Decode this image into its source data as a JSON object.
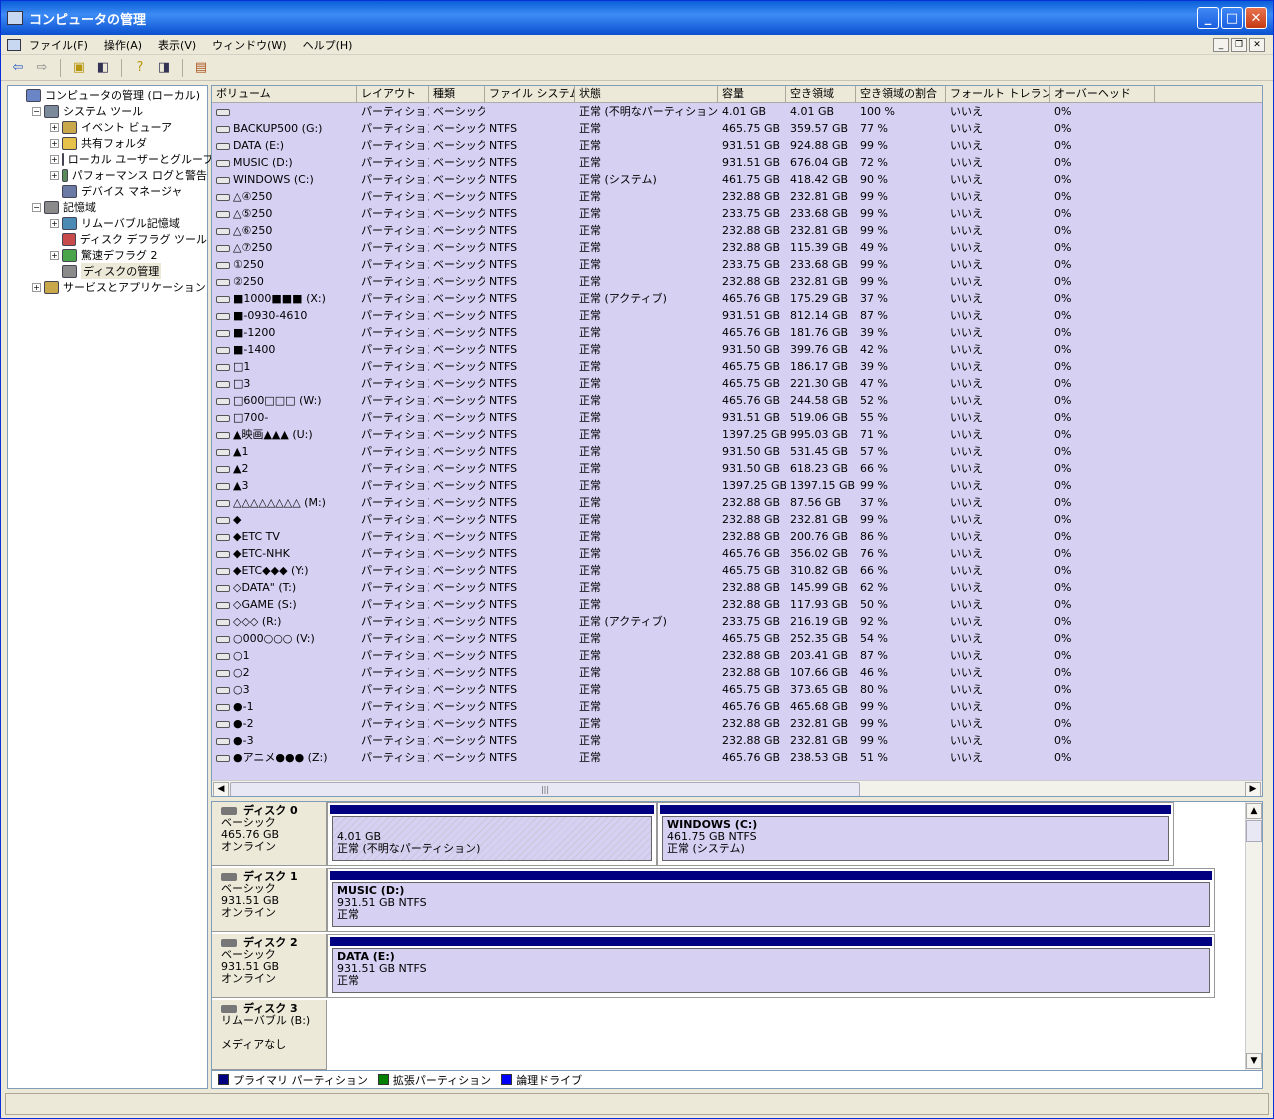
{
  "window": {
    "title": "コンピュータの管理"
  },
  "menu": [
    "ファイル(F)",
    "操作(A)",
    "表示(V)",
    "ウィンドウ(W)",
    "ヘルプ(H)"
  ],
  "tree": [
    {
      "label": "コンピュータの管理 (ローカル)",
      "level": 0,
      "exp": "",
      "icon": "computer-icon",
      "color": "#6b86c7"
    },
    {
      "label": "システム ツール",
      "level": 1,
      "exp": "⊟",
      "icon": "tools-icon",
      "color": "#7a8a9a"
    },
    {
      "label": "イベント ビューア",
      "level": 2,
      "exp": "⊞",
      "icon": "event-viewer-icon",
      "color": "#c8a84a"
    },
    {
      "label": "共有フォルダ",
      "level": 2,
      "exp": "⊞",
      "icon": "shared-folder-icon",
      "color": "#e6c24a"
    },
    {
      "label": "ローカル ユーザーとグループ",
      "level": 2,
      "exp": "⊞",
      "icon": "users-icon",
      "color": "#5a6ab5"
    },
    {
      "label": "パフォーマンス ログと警告",
      "level": 2,
      "exp": "⊞",
      "icon": "performance-icon",
      "color": "#5b8a5b"
    },
    {
      "label": "デバイス マネージャ",
      "level": 2,
      "exp": "",
      "icon": "device-manager-icon",
      "color": "#6a7aa5"
    },
    {
      "label": "記憶域",
      "level": 1,
      "exp": "⊟",
      "icon": "storage-icon",
      "color": "#8a8a8a"
    },
    {
      "label": "リムーバブル記憶域",
      "level": 2,
      "exp": "⊞",
      "icon": "removable-storage-icon",
      "color": "#4a8ab5"
    },
    {
      "label": "ディスク デフラグ ツール",
      "level": 2,
      "exp": "",
      "icon": "defrag-icon",
      "color": "#c84a4a"
    },
    {
      "label": "驚速デフラグ 2",
      "level": 2,
      "exp": "⊞",
      "icon": "defrag2-icon",
      "color": "#4aa54a"
    },
    {
      "label": "ディスクの管理",
      "level": 2,
      "exp": "",
      "icon": "disk-management-icon",
      "color": "#8a8a8a",
      "selected": true
    },
    {
      "label": "サービスとアプリケーション",
      "level": 1,
      "exp": "⊞",
      "icon": "services-icon",
      "color": "#c8a84a"
    }
  ],
  "columns": [
    "ボリューム",
    "レイアウト",
    "種類",
    "ファイル システム",
    "状態",
    "容量",
    "空き領域",
    "空き領域の割合",
    "フォールト トレランス",
    "オーバーヘッド"
  ],
  "rows": [
    [
      "",
      "パーティション",
      "ベーシック",
      "",
      "正常 (不明なパーティション)",
      "4.01 GB",
      "4.01 GB",
      "100 %",
      "いいえ",
      "0%"
    ],
    [
      "BACKUP500 (G:)",
      "パーティション",
      "ベーシック",
      "NTFS",
      "正常",
      "465.75 GB",
      "359.57 GB",
      "77 %",
      "いいえ",
      "0%"
    ],
    [
      "DATA (E:)",
      "パーティション",
      "ベーシック",
      "NTFS",
      "正常",
      "931.51 GB",
      "924.88 GB",
      "99 %",
      "いいえ",
      "0%"
    ],
    [
      "MUSIC (D:)",
      "パーティション",
      "ベーシック",
      "NTFS",
      "正常",
      "931.51 GB",
      "676.04 GB",
      "72 %",
      "いいえ",
      "0%"
    ],
    [
      "WINDOWS (C:)",
      "パーティション",
      "ベーシック",
      "NTFS",
      "正常 (システム)",
      "461.75 GB",
      "418.42 GB",
      "90 %",
      "いいえ",
      "0%"
    ],
    [
      "△④250",
      "パーティション",
      "ベーシック",
      "NTFS",
      "正常",
      "232.88 GB",
      "232.81 GB",
      "99 %",
      "いいえ",
      "0%"
    ],
    [
      "△⑤250",
      "パーティション",
      "ベーシック",
      "NTFS",
      "正常",
      "233.75 GB",
      "233.68 GB",
      "99 %",
      "いいえ",
      "0%"
    ],
    [
      "△⑥250",
      "パーティション",
      "ベーシック",
      "NTFS",
      "正常",
      "232.88 GB",
      "232.81 GB",
      "99 %",
      "いいえ",
      "0%"
    ],
    [
      "△⑦250",
      "パーティション",
      "ベーシック",
      "NTFS",
      "正常",
      "232.88 GB",
      "115.39 GB",
      "49 %",
      "いいえ",
      "0%"
    ],
    [
      "①250",
      "パーティション",
      "ベーシック",
      "NTFS",
      "正常",
      "233.75 GB",
      "233.68 GB",
      "99 %",
      "いいえ",
      "0%"
    ],
    [
      "②250",
      "パーティション",
      "ベーシック",
      "NTFS",
      "正常",
      "232.88 GB",
      "232.81 GB",
      "99 %",
      "いいえ",
      "0%"
    ],
    [
      "■1000■■■ (X:)",
      "パーティション",
      "ベーシック",
      "NTFS",
      "正常 (アクティブ)",
      "465.76 GB",
      "175.29 GB",
      "37 %",
      "いいえ",
      "0%"
    ],
    [
      "■-0930-4610",
      "パーティション",
      "ベーシック",
      "NTFS",
      "正常",
      "931.51 GB",
      "812.14 GB",
      "87 %",
      "いいえ",
      "0%"
    ],
    [
      "■-1200",
      "パーティション",
      "ベーシック",
      "NTFS",
      "正常",
      "465.76 GB",
      "181.76 GB",
      "39 %",
      "いいえ",
      "0%"
    ],
    [
      "■-1400",
      "パーティション",
      "ベーシック",
      "NTFS",
      "正常",
      "931.50 GB",
      "399.76 GB",
      "42 %",
      "いいえ",
      "0%"
    ],
    [
      "□1",
      "パーティション",
      "ベーシック",
      "NTFS",
      "正常",
      "465.75 GB",
      "186.17 GB",
      "39 %",
      "いいえ",
      "0%"
    ],
    [
      "□3",
      "パーティション",
      "ベーシック",
      "NTFS",
      "正常",
      "465.75 GB",
      "221.30 GB",
      "47 %",
      "いいえ",
      "0%"
    ],
    [
      "□600□□□ (W:)",
      "パーティション",
      "ベーシック",
      "NTFS",
      "正常",
      "465.76 GB",
      "244.58 GB",
      "52 %",
      "いいえ",
      "0%"
    ],
    [
      "□700-",
      "パーティション",
      "ベーシック",
      "NTFS",
      "正常",
      "931.51 GB",
      "519.06 GB",
      "55 %",
      "いいえ",
      "0%"
    ],
    [
      "▲映画▲▲▲ (U:)",
      "パーティション",
      "ベーシック",
      "NTFS",
      "正常",
      "1397.25 GB",
      "995.03 GB",
      "71 %",
      "いいえ",
      "0%"
    ],
    [
      "▲1",
      "パーティション",
      "ベーシック",
      "NTFS",
      "正常",
      "931.50 GB",
      "531.45 GB",
      "57 %",
      "いいえ",
      "0%"
    ],
    [
      "▲2",
      "パーティション",
      "ベーシック",
      "NTFS",
      "正常",
      "931.50 GB",
      "618.23 GB",
      "66 %",
      "いいえ",
      "0%"
    ],
    [
      "▲3",
      "パーティション",
      "ベーシック",
      "NTFS",
      "正常",
      "1397.25 GB",
      "1397.15 GB",
      "99 %",
      "いいえ",
      "0%"
    ],
    [
      "△△△△△△△△ (M:)",
      "パーティション",
      "ベーシック",
      "NTFS",
      "正常",
      "232.88 GB",
      "87.56 GB",
      "37 %",
      "いいえ",
      "0%"
    ],
    [
      "◆",
      "パーティション",
      "ベーシック",
      "NTFS",
      "正常",
      "232.88 GB",
      "232.81 GB",
      "99 %",
      "いいえ",
      "0%"
    ],
    [
      "◆ETC TV",
      "パーティション",
      "ベーシック",
      "NTFS",
      "正常",
      "232.88 GB",
      "200.76 GB",
      "86 %",
      "いいえ",
      "0%"
    ],
    [
      "◆ETC-NHK",
      "パーティション",
      "ベーシック",
      "NTFS",
      "正常",
      "465.76 GB",
      "356.02 GB",
      "76 %",
      "いいえ",
      "0%"
    ],
    [
      "◆ETC◆◆◆ (Y:)",
      "パーティション",
      "ベーシック",
      "NTFS",
      "正常",
      "465.75 GB",
      "310.82 GB",
      "66 %",
      "いいえ",
      "0%"
    ],
    [
      "◇DATA\" (T:)",
      "パーティション",
      "ベーシック",
      "NTFS",
      "正常",
      "232.88 GB",
      "145.99 GB",
      "62 %",
      "いいえ",
      "0%"
    ],
    [
      "◇GAME (S:)",
      "パーティション",
      "ベーシック",
      "NTFS",
      "正常",
      "232.88 GB",
      "117.93 GB",
      "50 %",
      "いいえ",
      "0%"
    ],
    [
      "◇◇◇ (R:)",
      "パーティション",
      "ベーシック",
      "NTFS",
      "正常 (アクティブ)",
      "233.75 GB",
      "216.19 GB",
      "92 %",
      "いいえ",
      "0%"
    ],
    [
      "○000○○○ (V:)",
      "パーティション",
      "ベーシック",
      "NTFS",
      "正常",
      "465.75 GB",
      "252.35 GB",
      "54 %",
      "いいえ",
      "0%"
    ],
    [
      "○1",
      "パーティション",
      "ベーシック",
      "NTFS",
      "正常",
      "232.88 GB",
      "203.41 GB",
      "87 %",
      "いいえ",
      "0%"
    ],
    [
      "○2",
      "パーティション",
      "ベーシック",
      "NTFS",
      "正常",
      "232.88 GB",
      "107.66 GB",
      "46 %",
      "いいえ",
      "0%"
    ],
    [
      "○3",
      "パーティション",
      "ベーシック",
      "NTFS",
      "正常",
      "465.75 GB",
      "373.65 GB",
      "80 %",
      "いいえ",
      "0%"
    ],
    [
      "●-1",
      "パーティション",
      "ベーシック",
      "NTFS",
      "正常",
      "465.76 GB",
      "465.68 GB",
      "99 %",
      "いいえ",
      "0%"
    ],
    [
      "●-2",
      "パーティション",
      "ベーシック",
      "NTFS",
      "正常",
      "232.88 GB",
      "232.81 GB",
      "99 %",
      "いいえ",
      "0%"
    ],
    [
      "●-3",
      "パーティション",
      "ベーシック",
      "NTFS",
      "正常",
      "232.88 GB",
      "232.81 GB",
      "99 %",
      "いいえ",
      "0%"
    ],
    [
      "●アニメ●●● (Z:)",
      "パーティション",
      "ベーシック",
      "NTFS",
      "正常",
      "465.76 GB",
      "238.53 GB",
      "51 %",
      "いいえ",
      "0%"
    ]
  ],
  "disks": [
    {
      "name": "ディスク 0",
      "type": "ベーシック",
      "size": "465.76 GB",
      "status": "オンライン",
      "partitions": [
        {
          "name": "",
          "size": "4.01 GB",
          "status": "正常 (不明なパーティション)",
          "hatched": true
        },
        {
          "name": "WINDOWS (C:)",
          "size": "461.75 GB NTFS",
          "status": "正常 (システム)",
          "hatched": false
        }
      ]
    },
    {
      "name": "ディスク 1",
      "type": "ベーシック",
      "size": "931.51 GB",
      "status": "オンライン",
      "partitions": [
        {
          "name": "MUSIC (D:)",
          "size": "931.51 GB NTFS",
          "status": "正常",
          "hatched": false
        }
      ]
    },
    {
      "name": "ディスク 2",
      "type": "ベーシック",
      "size": "931.51 GB",
      "status": "オンライン",
      "partitions": [
        {
          "name": "DATA (E:)",
          "size": "931.51 GB NTFS",
          "status": "正常",
          "hatched": false
        }
      ]
    },
    {
      "name": "ディスク 3",
      "type": "リムーバブル (B:)",
      "size": "",
      "status": "メディアなし",
      "partitions": []
    }
  ],
  "legend": [
    {
      "label": "プライマリ パーティション",
      "color": "#000080"
    },
    {
      "label": "拡張パーティション",
      "color": "#008000"
    },
    {
      "label": "論理ドライブ",
      "color": "#0000ff"
    }
  ]
}
